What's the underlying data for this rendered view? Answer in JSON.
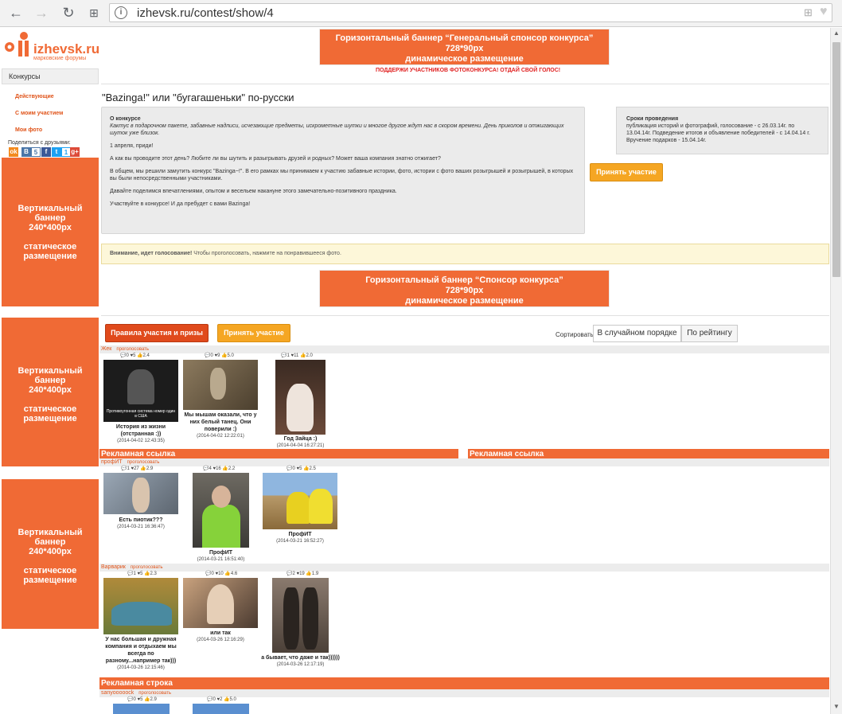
{
  "browser": {
    "url": "izhevsk.ru/contest/show/4"
  },
  "logo": {
    "name": "izhevsk.ru",
    "sub": "марковские форумы"
  },
  "sidebar": {
    "header": "Конкурсы",
    "items": [
      {
        "label": "Действующие"
      },
      {
        "label": "С моим участием"
      },
      {
        "label": "Мои фото"
      }
    ],
    "share_label": "Поделиться с друзьями:",
    "share_icons": [
      {
        "name": "ok-icon",
        "glyph": "ok",
        "color": "#f38a1e"
      },
      {
        "name": "vk-icon",
        "glyph": "В",
        "color": "#4a76a8"
      },
      {
        "name": "count",
        "glyph": "5",
        "color": "#4a76a8"
      },
      {
        "name": "facebook-icon",
        "glyph": "f",
        "color": "#3b5998"
      },
      {
        "name": "twitter-icon",
        "glyph": "t",
        "color": "#1da1f2"
      },
      {
        "name": "count2",
        "glyph": "1",
        "color": "#1da1f2"
      },
      {
        "name": "gplus-icon",
        "glyph": "g+",
        "color": "#dd4b39"
      }
    ]
  },
  "banners": {
    "top": {
      "line1": "Горизонтальный баннер “Генеральный спонсор конкурса”",
      "line2": "728*90px",
      "line3": "динамическое размещение"
    },
    "middle": {
      "line1": "Горизонтальный баннер “Спонсор конкурса”",
      "line2": "728*90px",
      "line3": "динамическое размещение"
    },
    "vertical": {
      "line1": "Вертикальный баннер",
      "line2": "240*400px",
      "line3": "статическое",
      "line4": "размещение"
    }
  },
  "support_text": "ПОДДЕРЖИ УЧАСТНИКОВ ФОТОКОНКУРСА! ОТДАЙ СВОЙ ГОЛОС!",
  "contest": {
    "title": "\"Bazinga!\" или \"бугагашеньки\" по-русски",
    "about_heading": "О конкурсе",
    "about_intro": "Кактус в подарочном пакете, забавные надписи, исчезающие предметы, искрометные шутки и многое другое ждут нас в скором времени. День приколов и отжигающих шуток уже близок.",
    "p1": "1 апреля, приди!",
    "p2": "А как вы проводите этот день? Любите ли вы шутить и разыгрывать друзей и родных? Может ваша компания знатно отжигает?",
    "p3": "В общем, мы решили замутить конкурс \"Bazinga~!\". В его рамках мы принимаем к участию забавные истории, фото, истории с фото ваших розыгрышей и розыгрышей, в которых вы были непосредственными участниками.",
    "p4": "Давайте поделимся впечатлениями, опытом и весельем накануне этого замечательно-позитивного праздника.",
    "p5": "Участвуйте в конкурсе! И да пребудет с вами Bazinga!",
    "dates_heading": "Сроки проведения",
    "dates_text": "публикация историй и фотографий, голосование - с 26.03.14г. по 13.04.14г. Подведение итогов и объявление победителей - с 14.04.14 г. Вручение подарков - 15.04.14г.",
    "participate_label": "Принять участие",
    "notice_bold": "Внимание, идет голосование!",
    "notice_text": " Чтобы проголосовать, нажмите на понравившееся фото."
  },
  "actions": {
    "rules_label": "Правила участия и призы",
    "participate_label": "Принять участие",
    "sort_label": "Сортировать:",
    "sort_random": "В случайном порядке",
    "sort_rating": "По рейтингу"
  },
  "vote_label": "проголосовать",
  "ad_link": "Рекламная ссылка",
  "ad_row": "Рекламная строка",
  "groups": [
    {
      "user": "Жек",
      "photos": [
        {
          "comments": "0",
          "likes": "5",
          "rating": "2.4",
          "caption": "История из жизни (отстранная :))",
          "date": "(2014-04-02 12:43:35)",
          "img_text": "Противоугонная система номер один в США"
        },
        {
          "comments": "0",
          "likes": "9",
          "rating": "5.0",
          "caption": "Мы мышам оказали, что у них белый танец. Они поверили :)",
          "date": "(2014-04-02 12:22:01)"
        },
        {
          "comments": "1",
          "likes": "11",
          "rating": "2.0",
          "caption": "Год Зайца :)",
          "date": "(2014-04-04 16:27:21)"
        }
      ]
    },
    {
      "user": "профИТ",
      "photos": [
        {
          "comments": "1",
          "likes": "27",
          "rating": "2.9",
          "caption": "Есть пиотик???",
          "date": "(2014-03-21 16:36:47)"
        },
        {
          "comments": "4",
          "likes": "16",
          "rating": "2.2",
          "caption": "ПрофИТ",
          "date": "(2014-03-21 16:51:40)"
        },
        {
          "comments": "0",
          "likes": "5",
          "rating": "2.5",
          "caption": "ПрофИТ",
          "date": "(2014-03-21 16:52:27)"
        }
      ]
    },
    {
      "user": "Варварик",
      "photos": [
        {
          "comments": "1",
          "likes": "5",
          "rating": "2.3",
          "caption": "У нас большая и дружная компания и отдыхаем мы всегда по разному...например так)))",
          "date": "(2014-03-26 12:15:46)"
        },
        {
          "comments": "0",
          "likes": "10",
          "rating": "4.6",
          "caption": "или так",
          "date": "(2014-03-26 12:16:29)"
        },
        {
          "comments": "2",
          "likes": "19",
          "rating": "1.9",
          "caption": "а бывает, что даже и так))))))",
          "date": "(2014-03-26 12:17:19)"
        }
      ]
    },
    {
      "user": "sanyooooock",
      "photos": [
        {
          "comments": "0",
          "likes": "5",
          "rating": "2.9"
        },
        {
          "comments": "0",
          "likes": "2",
          "rating": "5.0"
        }
      ]
    }
  ],
  "colors": {
    "accent": "#f06a35",
    "button": "#f5a623",
    "link": "#e0541a"
  }
}
